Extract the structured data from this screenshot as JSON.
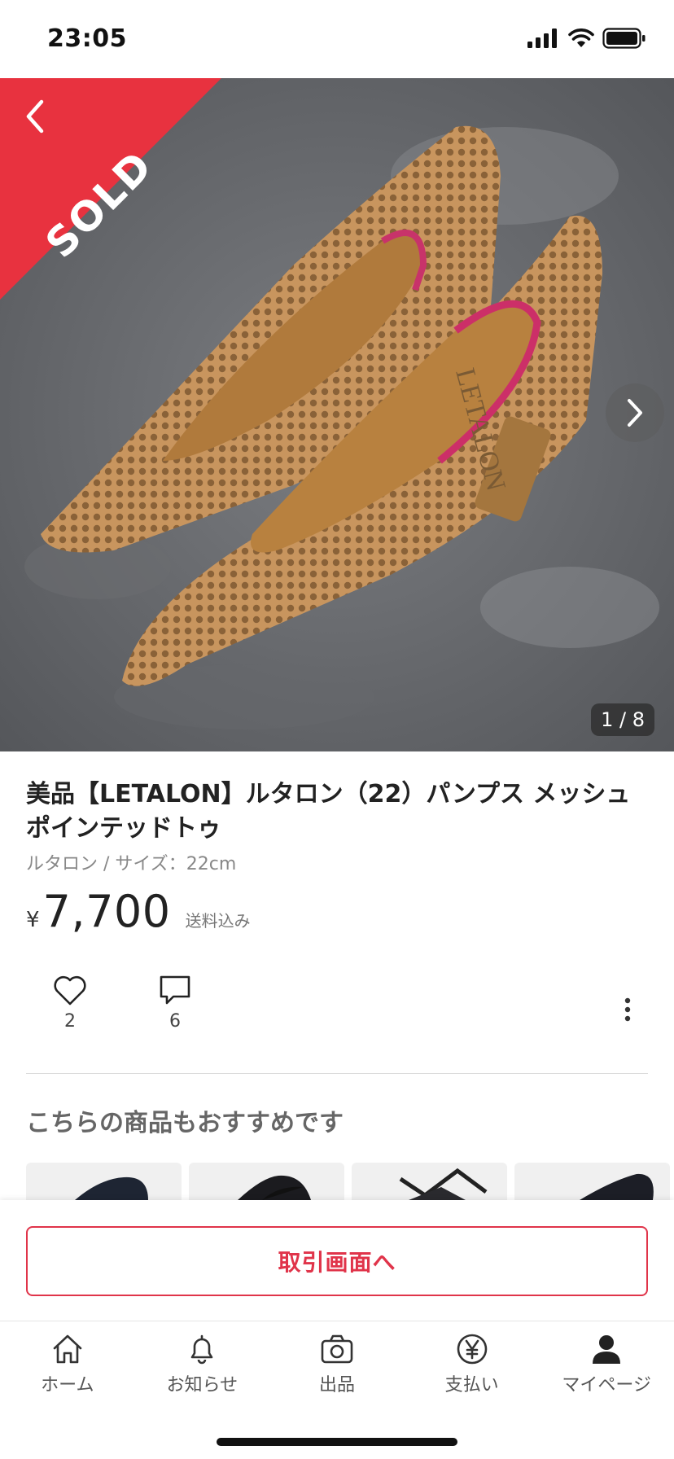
{
  "status_bar": {
    "time": "23:05",
    "icons": [
      "signal-icon",
      "wifi-icon",
      "battery-icon"
    ]
  },
  "hero": {
    "sold_label": "SOLD",
    "page_counter": "1 / 8",
    "brand_print": "LETALON",
    "colors": {
      "sold": "#e8323f"
    }
  },
  "product": {
    "title": "美品【LETALON】ルタロン（22）パンプス メッシュ　ポインテッドトゥ",
    "subtitle": "ルタロン / サイズ：22cm",
    "price_currency": "¥",
    "price": "7,700",
    "shipping": "送料込み",
    "likes": "2",
    "comments": "6"
  },
  "recommendations": {
    "heading": "こちらの商品もおすすめです",
    "count_visible": 4
  },
  "cta": {
    "label": "取引画面へ",
    "color": "#e0344a"
  },
  "tabs": [
    {
      "label": "ホーム",
      "icon": "home-icon"
    },
    {
      "label": "お知らせ",
      "icon": "bell-icon"
    },
    {
      "label": "出品",
      "icon": "camera-icon"
    },
    {
      "label": "支払い",
      "icon": "yen-icon"
    },
    {
      "label": "マイページ",
      "icon": "person-icon"
    }
  ]
}
